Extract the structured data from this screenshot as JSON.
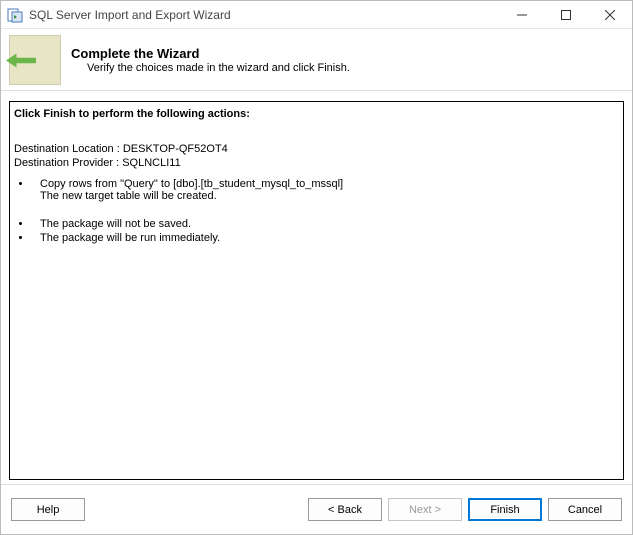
{
  "window": {
    "title": "SQL Server Import and Export Wizard"
  },
  "header": {
    "title": "Complete the Wizard",
    "subtitle": "Verify the choices made in the wizard and click Finish."
  },
  "content": {
    "section_head": "Click Finish to perform the following actions:",
    "dest_location": "Destination Location : DESKTOP-QF52OT4",
    "dest_provider": "Destination Provider : SQLNCLI11",
    "action1_line1": "Copy rows from \"Query\" to [dbo].[tb_student_mysql_to_mssql]",
    "action1_line2": "The new target table will be created.",
    "action2": "The package will not be saved.",
    "action3": "The package will be run immediately."
  },
  "footer": {
    "help": "Help",
    "back": "< Back",
    "next": "Next >",
    "finish": "Finish",
    "cancel": "Cancel"
  }
}
